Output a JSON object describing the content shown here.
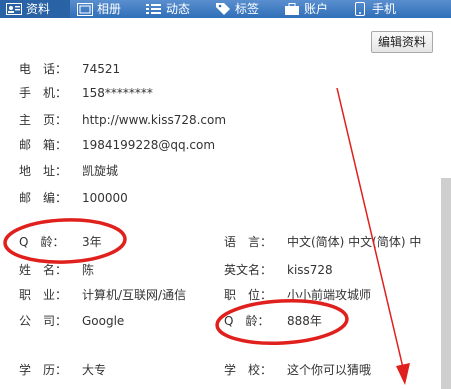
{
  "tabs": [
    {
      "label": "资料",
      "icon": "profile-card-icon",
      "active": true
    },
    {
      "label": "相册",
      "icon": "photo-album-icon",
      "active": false
    },
    {
      "label": "动态",
      "icon": "list-icon",
      "active": false
    },
    {
      "label": "标签",
      "icon": "tag-icon",
      "active": false
    },
    {
      "label": "账户",
      "icon": "briefcase-icon",
      "active": false
    },
    {
      "label": "手机",
      "icon": "phone-icon",
      "active": false
    }
  ],
  "edit_button": {
    "label": "编辑资料"
  },
  "contact": {
    "phone": {
      "label": "电　话：",
      "value": "74521"
    },
    "mobile": {
      "label": "手　机：",
      "value": "158********"
    },
    "homepage": {
      "label": "主　页：",
      "value": "http://www.kiss728.com"
    },
    "email": {
      "label": "邮　箱：",
      "value": "1984199228@qq.com"
    },
    "address": {
      "label": "地　址：",
      "value": "凯旋城"
    },
    "postcode": {
      "label": "邮　编：",
      "value": "100000"
    }
  },
  "details": {
    "qage": {
      "label": "Q　龄：",
      "value": "3年"
    },
    "language": {
      "label": "语　言：",
      "value": "中文(简体)  中文(简体)  中"
    },
    "surname": {
      "label": "姓　名：",
      "value": "陈"
    },
    "english_name": {
      "label": "英文名：",
      "value": "kiss728"
    },
    "occupation": {
      "label": "职　业：",
      "value": "计算机/互联网/通信"
    },
    "position": {
      "label": "职　位：",
      "value": "小小前端攻城师"
    },
    "company": {
      "label": "公　司：",
      "value": "Google"
    },
    "qage2": {
      "label": "Q　龄：",
      "value": "888年"
    },
    "education": {
      "label": "学　历：",
      "value": "大专"
    },
    "school": {
      "label": "学　校：",
      "value": "这个你可以猜哦"
    }
  },
  "colors": {
    "tabbar": "#2f6fb8",
    "annotation": "#e0201c"
  }
}
